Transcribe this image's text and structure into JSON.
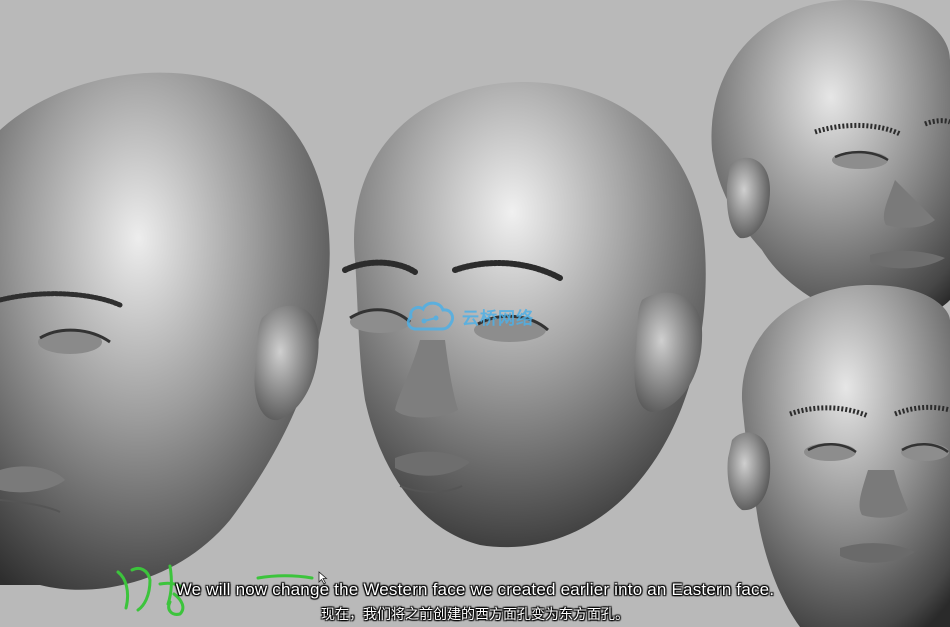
{
  "video": {
    "subtitle_en": "We will now change the Western face we created earlier into an Eastern face.",
    "subtitle_zh": "现在，我们将之前创建的西方面孔变为东方面孔。",
    "watermark_text": "云桥网络",
    "watermark_icon": "cloud-icon",
    "colors": {
      "background": "#b9b9b9",
      "sketch_stroke": "#3cc43c",
      "watermark": "#4fb0e6",
      "subtitle": "#ffffff"
    }
  }
}
